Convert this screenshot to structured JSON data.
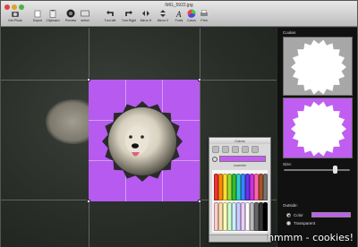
{
  "window": {
    "title": "IMG_5922.jpg"
  },
  "toolbar": {
    "items": [
      {
        "label": "Get Photo",
        "icon": "camera-icon"
      },
      {
        "label": "Export",
        "icon": "export-icon"
      },
      {
        "label": "Clipboard",
        "icon": "clipboard-icon"
      },
      {
        "label": "Preview",
        "icon": "preview-icon"
      },
      {
        "label": "select",
        "icon": "select-icon"
      },
      {
        "label": "Turn left",
        "icon": "rotate-left-icon"
      },
      {
        "label": "Turn Right",
        "icon": "rotate-right-icon"
      },
      {
        "label": "Mirror H",
        "icon": "mirror-h-icon"
      },
      {
        "label": "Mirror V",
        "icon": "mirror-v-icon"
      },
      {
        "label": "Fonts",
        "icon": "fonts-icon"
      },
      {
        "label": "Colors",
        "icon": "colors-icon"
      },
      {
        "label": "Print",
        "icon": "print-icon"
      }
    ]
  },
  "colors_panel": {
    "title": "Colors",
    "palette_name": "Lavender",
    "selected_color": "#c55cf0"
  },
  "side_panel": {
    "cookie_label": "Cookie:",
    "size_label": "Size:",
    "outside_label": "Outside:",
    "option_color": "Color",
    "option_transparent": "Transparent",
    "size_level": 0.78,
    "outside_color": "#bf5ef1"
  },
  "caption": "hmmm - cookies!",
  "colors": {
    "accent_purple": "#b65af0"
  }
}
